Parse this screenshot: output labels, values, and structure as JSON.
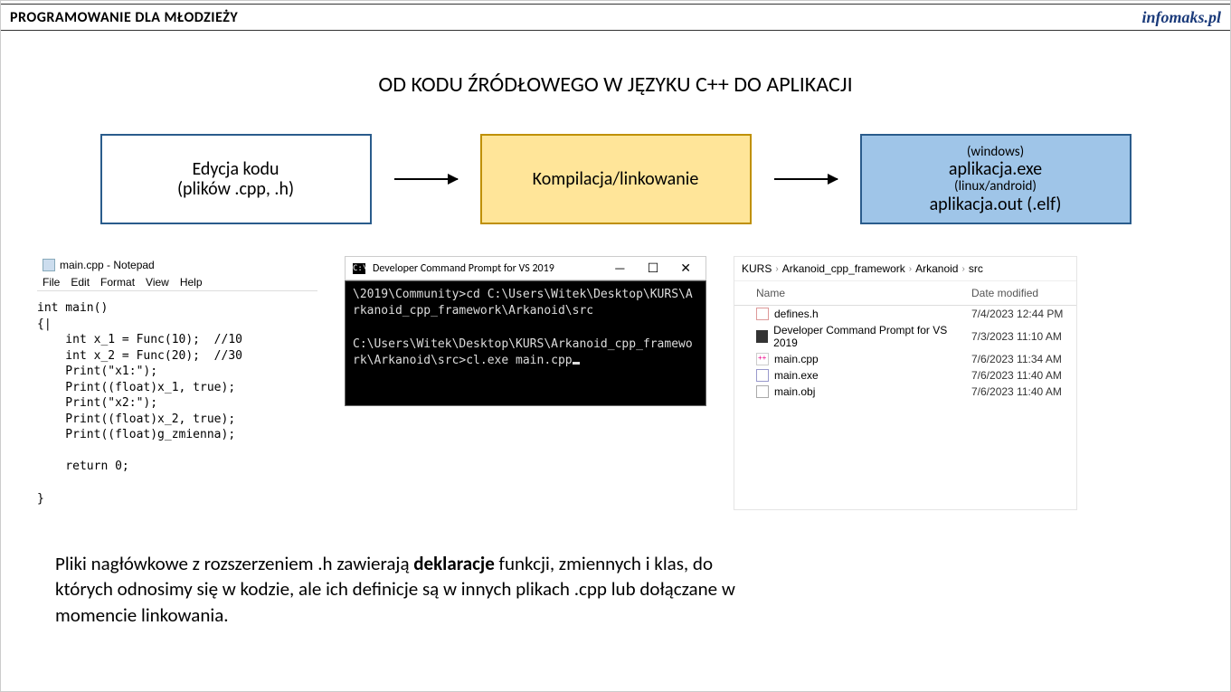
{
  "header": {
    "left": "PROGRAMOWANIE DLA MŁODZIEŻY",
    "right": "infomaks.pl"
  },
  "title": "OD KODU ŹRÓDŁOWEGO W JĘZYKU C++ DO APLIKACJI",
  "boxes": {
    "edit_l1": "Edycja kodu",
    "edit_l2": "(plików .cpp, .h)",
    "compile": "Kompilacja/linkowanie",
    "out_win_label": "(windows)",
    "out_win_file": "aplikacja.exe",
    "out_linux_label": "(linux/android)",
    "out_linux_file": "aplikacja.out (.elf)"
  },
  "notepad": {
    "title": "main.cpp - Notepad",
    "menu": [
      "File",
      "Edit",
      "Format",
      "View",
      "Help"
    ],
    "code": "int main()\n{|\n    int x_1 = Func(10);  //10\n    int x_2 = Func(20);  //30\n    Print(\"x1:\");\n    Print((float)x_1, true);\n    Print(\"x2:\");\n    Print((float)x_2, true);\n    Print((float)g_zmienna);\n\n    return 0;\n\n}"
  },
  "terminal": {
    "title": "Developer Command Prompt for VS 2019",
    "minimize": "—",
    "maximize": "☐",
    "close": "✕",
    "line1": "\\2019\\Community>cd C:\\Users\\Witek\\Desktop\\KURS\\Arkanoid_cpp_framework\\Arkanoid\\src",
    "line2": "C:\\Users\\Witek\\Desktop\\KURS\\Arkanoid_cpp_framework\\Arkanoid\\src>cl.exe main.cpp"
  },
  "explorer": {
    "crumbs": [
      "KURS",
      "Arkanoid_cpp_framework",
      "Arkanoid",
      "src"
    ],
    "col_name": "Name",
    "col_date": "Date modified",
    "files": [
      {
        "icon": "ficon-h",
        "name": "defines.h",
        "date": "7/4/2023 12:44 PM"
      },
      {
        "icon": "ficon-cmd",
        "name": "Developer Command Prompt for VS 2019",
        "date": "7/3/2023 11:10 AM"
      },
      {
        "icon": "ficon-cpp",
        "name": "main.cpp",
        "date": "7/6/2023 11:34 AM"
      },
      {
        "icon": "ficon-exe",
        "name": "main.exe",
        "date": "7/6/2023 11:40 AM"
      },
      {
        "icon": "ficon-obj",
        "name": "main.obj",
        "date": "7/6/2023 11:40 AM"
      }
    ]
  },
  "footer": {
    "t1": "Pliki nagłówkowe z rozszerzeniem .h zawierają ",
    "bold": "deklaracje",
    "t2": " funkcji, zmiennych i klas, do których odnosimy się w kodzie, ale ich definicje są w innych plikach .cpp lub dołączane w momencie linkowania."
  }
}
